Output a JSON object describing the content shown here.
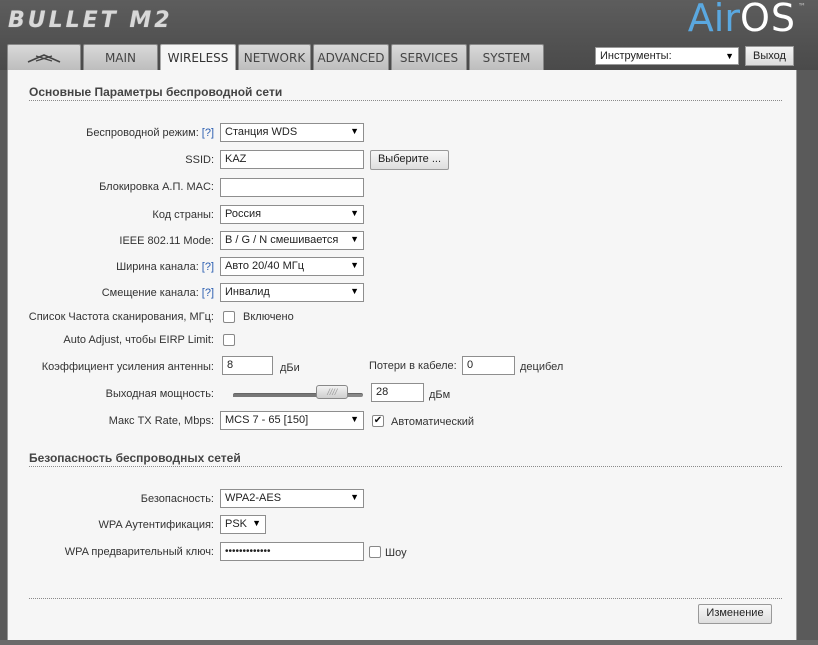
{
  "header": {
    "product_logo": "BULLET M2",
    "brand_main": "Air",
    "brand_os": "OS",
    "brand_tm": "™"
  },
  "tabs": [
    {
      "label": "",
      "icon": "ubiquiti-logo-icon",
      "active": false
    },
    {
      "label": "Main",
      "active": false
    },
    {
      "label": "Wireless",
      "active": true
    },
    {
      "label": "Network",
      "active": false
    },
    {
      "label": "Advanced",
      "active": false
    },
    {
      "label": "Services",
      "active": false
    },
    {
      "label": "System",
      "active": false
    }
  ],
  "tools": {
    "selected": "Инструменты:",
    "logout_label": "Выход"
  },
  "basic": {
    "title": "Основные Параметры беспроводной сети",
    "help_marker": "[?]",
    "wireless_mode": {
      "label": "Беспроводной режим:",
      "value": "Станция WDS"
    },
    "ssid": {
      "label": "SSID:",
      "value": "KAZ",
      "select_button": "Выберите ..."
    },
    "ap_mac": {
      "label": "Блокировка А.П. MAC:",
      "value": ""
    },
    "country": {
      "label": "Код страны:",
      "value": "Россия"
    },
    "ieee_mode": {
      "label": "IEEE 802.11 Mode:",
      "value": "B / G / N смешивается"
    },
    "channel_width": {
      "label": "Ширина канала:",
      "value": "Авто 20/40 МГц"
    },
    "channel_shift": {
      "label": "Смещение канала:",
      "value": "Инвалид"
    },
    "scan_list": {
      "label": "Список Частота сканирования, МГц:",
      "checkbox_label": "Включено",
      "checked": false
    },
    "auto_adjust": {
      "label": "Auto Adjust, чтобы EIRP Limit:",
      "checked": false
    },
    "antenna_gain": {
      "label": "Коэффициент усиления антенны:",
      "value": "8",
      "unit": "дБи"
    },
    "cable_loss": {
      "label": "Потери в кабеле:",
      "value": "0",
      "unit": "децибел"
    },
    "output_power": {
      "label": "Выходная мощность:",
      "value": "28",
      "unit": "дБм",
      "level": 0.85
    },
    "max_tx_rate": {
      "label": "Макс TX Rate, Mbps:",
      "value": "MCS 7 - 65 [150]",
      "auto_label": "Автоматический",
      "auto_checked": true
    }
  },
  "security": {
    "title": "Безопасность беспроводных сетей",
    "security": {
      "label": "Безопасность:",
      "value": "WPA2-AES"
    },
    "wpa_auth": {
      "label": "WPA Аутентификация:",
      "value": "PSK"
    },
    "wpa_key": {
      "label": "WPA предварительный ключ:",
      "value": "•••••••••••••",
      "show_label": "Шоу",
      "show_checked": false
    }
  },
  "footer": {
    "change_button": "Изменение"
  }
}
